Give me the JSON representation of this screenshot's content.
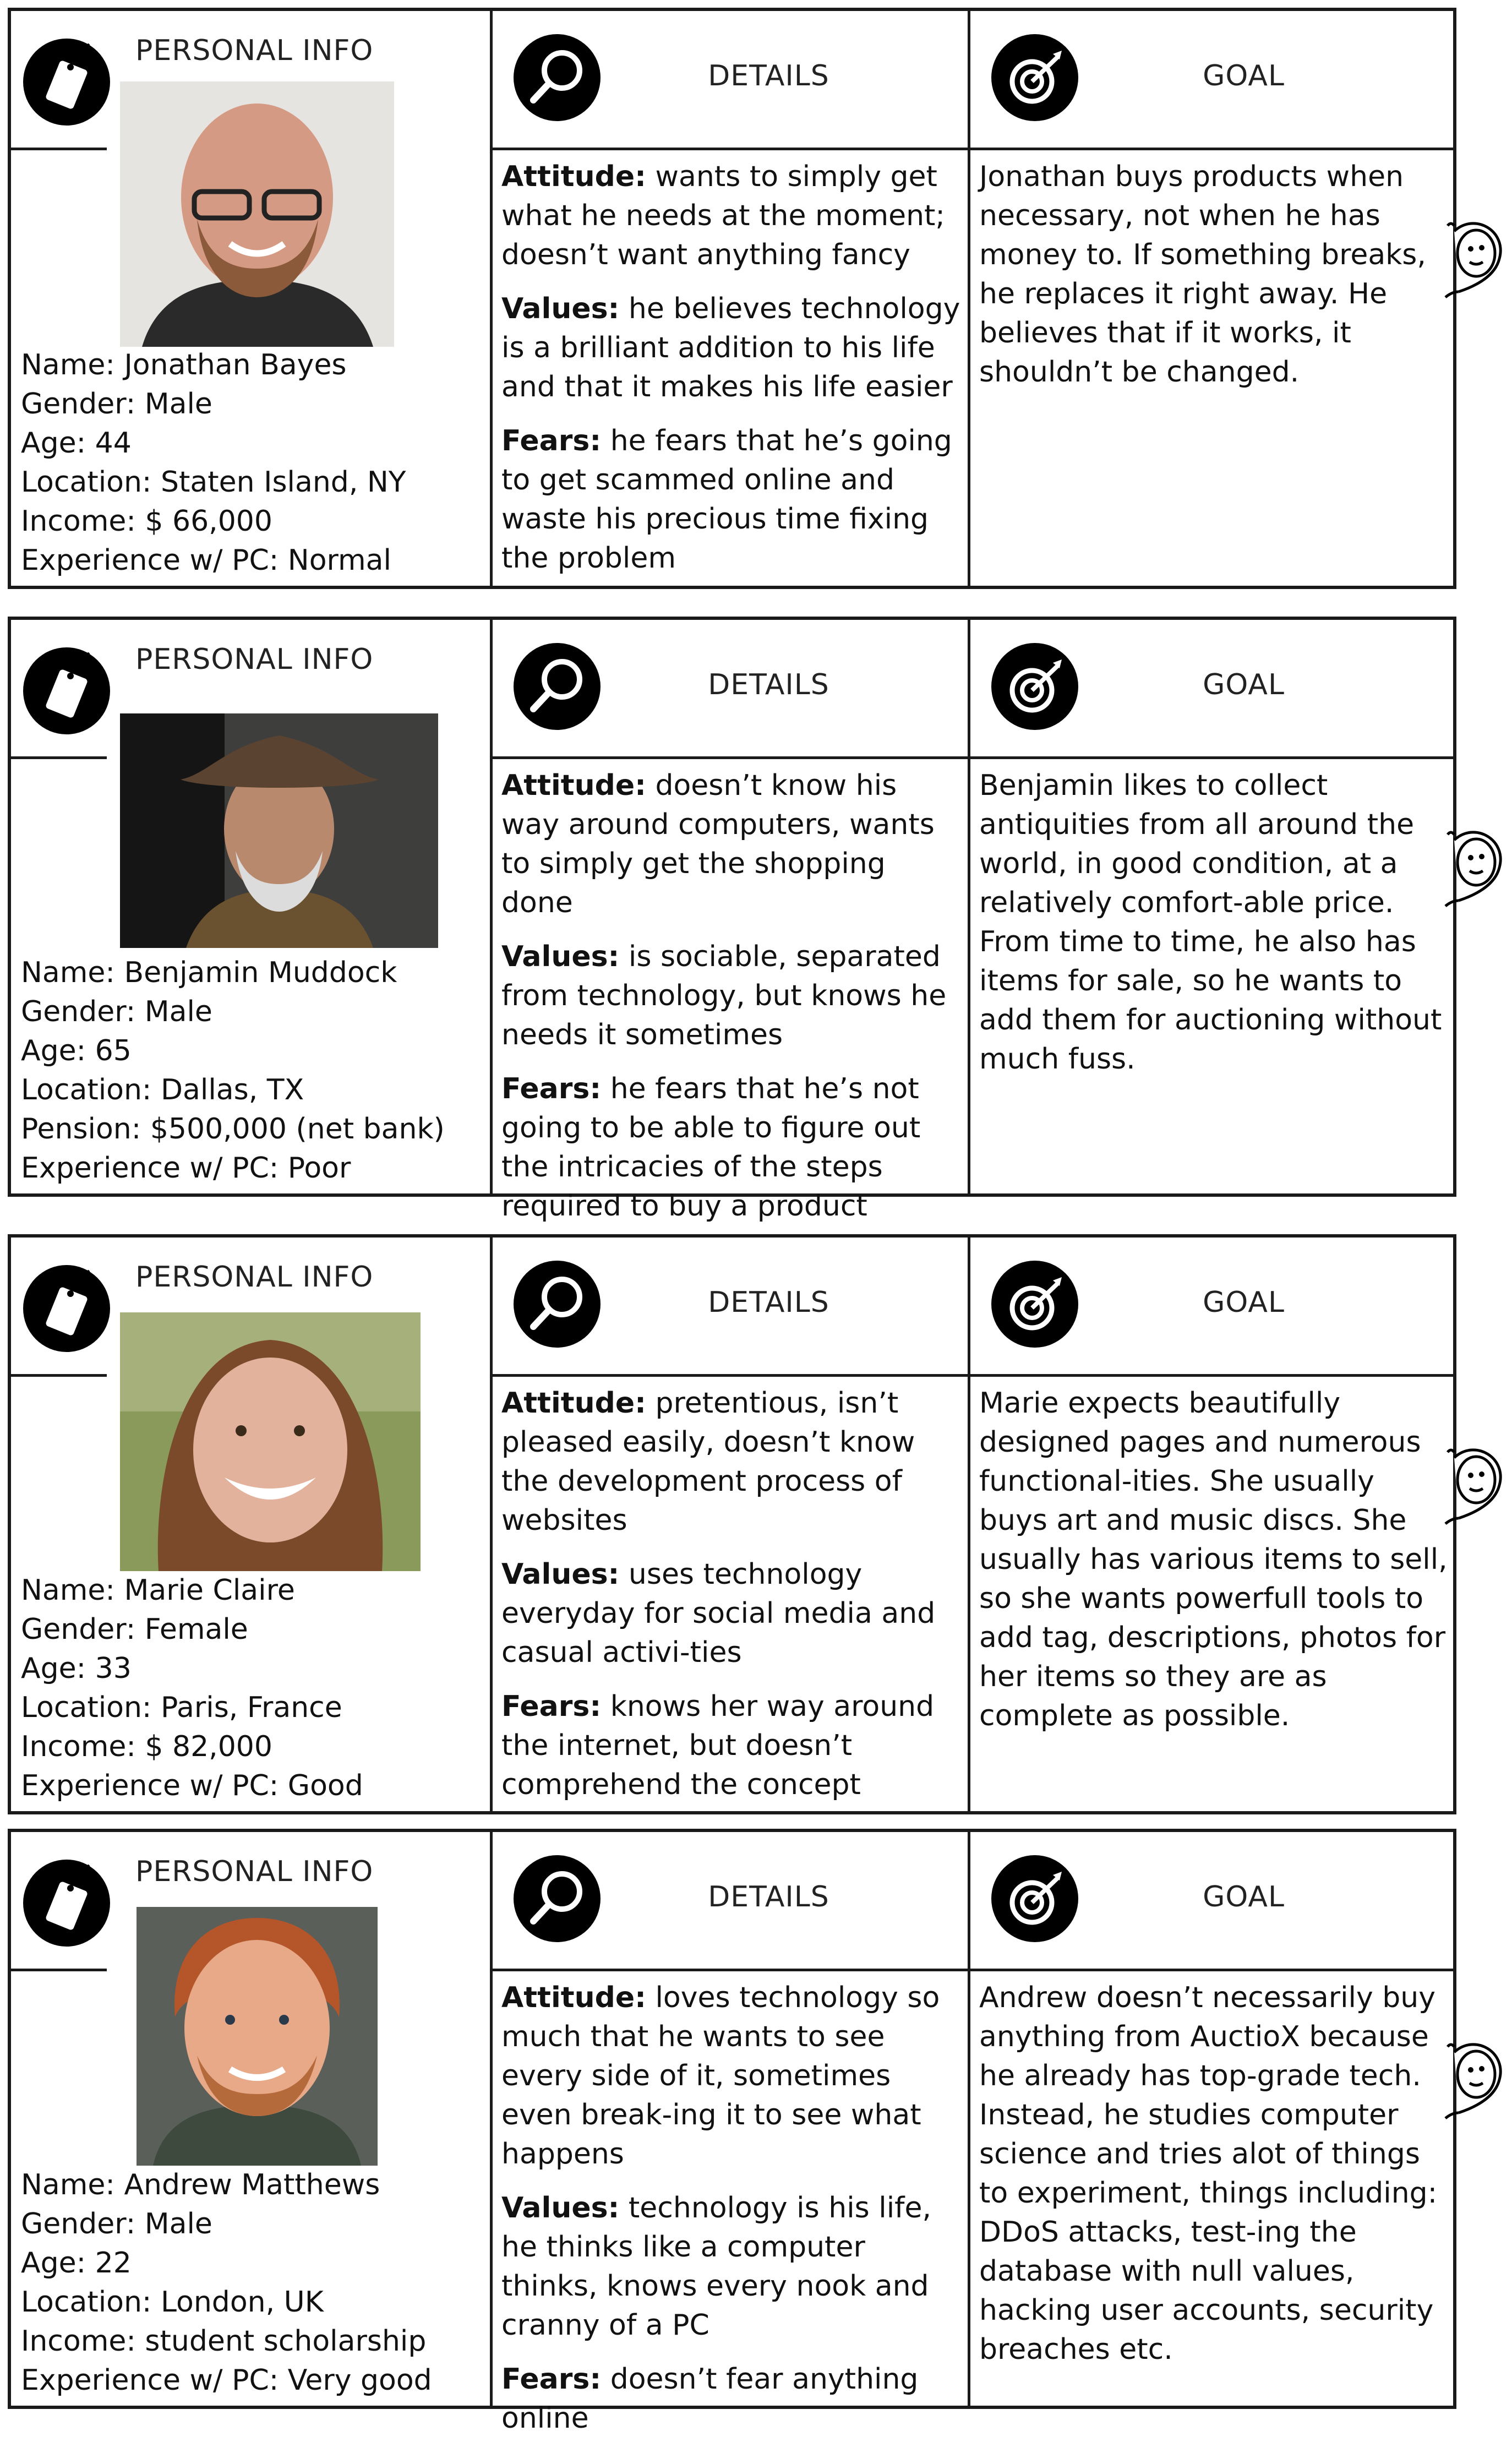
{
  "headers": {
    "personal_info": "PERSONAL INFO",
    "details": "DETAILS",
    "goal": "GOAL"
  },
  "labels": {
    "attitude": "Attitude:",
    "values": "Values:",
    "fears": "Fears:"
  },
  "icons": {
    "personal_info": "tag-icon",
    "details": "magnifier-icon",
    "goal": "target-icon",
    "side": "mascot-icon"
  },
  "personas": [
    {
      "photo": "photo-jonathan-bayes",
      "info": [
        "Name: Jonathan Bayes",
        "Gender: Male",
        "Age: 44",
        "Location: Staten Island, NY",
        "Income: $ 66,000",
        "Experience w/ PC: Normal"
      ],
      "attitude": "wants to simply get what he needs at the moment; doesn’t want anything fancy",
      "values": "he believes technology is a brilliant addition to his life and that it makes his life easier",
      "fears": "he fears that he’s going to get scammed online and waste his precious time fixing the problem",
      "goal": "Jonathan buys products when necessary, not when he has money to. If something breaks,  he replaces it right away. He believes that if it works, it shouldn’t be changed."
    },
    {
      "photo": "photo-benjamin-muddock",
      "info": [
        "Name: Benjamin Muddock",
        "Gender: Male",
        "Age: 65",
        "Location: Dallas, TX",
        "Pension: $500,000 (net bank)",
        "Experience w/ PC: Poor"
      ],
      "attitude": "doesn’t know his way around computers, wants to simply get the shopping done",
      "values": "is sociable, separated from technology, but knows he needs it sometimes",
      "fears": "he fears that he’s not going to be able to figure out the intricacies of the steps required to buy a product",
      "goal": "Benjamin likes to collect antiquities from all around the world, in good condition, at a relatively comfort-able price. From time to time, he also has items for sale, so he wants to add them for auctioning without much fuss."
    },
    {
      "photo": "photo-marie-claire",
      "info": [
        "Name: Marie Claire",
        "Gender: Female",
        "Age: 33",
        "Location: Paris, France",
        "Income: $ 82,000",
        "Experience w/ PC: Good"
      ],
      "attitude": "pretentious, isn’t pleased easily, doesn’t know the development process of websites",
      "values": "uses technology everyday for social media and casual activi-ties",
      "fears": "knows her way around the internet, but doesn’t comprehend the concept",
      "goal": "Marie expects beautifully designed pages and numerous functional-ities. She usually buys art and music discs. She usually has various items to sell, so she wants powerfull tools to add tag, descriptions, photos for her items so they are as complete as possible."
    },
    {
      "photo": "photo-andrew-matthews",
      "info": [
        "Name: Andrew Matthews",
        "Gender: Male",
        "Age: 22",
        "Location: London, UK",
        "Income: student scholarship",
        "Experience w/ PC: Very good"
      ],
      "attitude": "loves technology so much that he wants to see every side of it, sometimes even break-ing it to see what happens",
      "values": "technology is his life, he thinks like a computer thinks, knows every nook and cranny of a PC",
      "fears": "doesn’t fear anything online",
      "goal": "Andrew doesn’t necessarily buy anything from AuctioX because he already has top-grade tech. Instead, he studies computer science and tries alot of things to experiment, things including: DDoS attacks, test-ing the database with null values, hacking user accounts, security breaches etc."
    }
  ]
}
